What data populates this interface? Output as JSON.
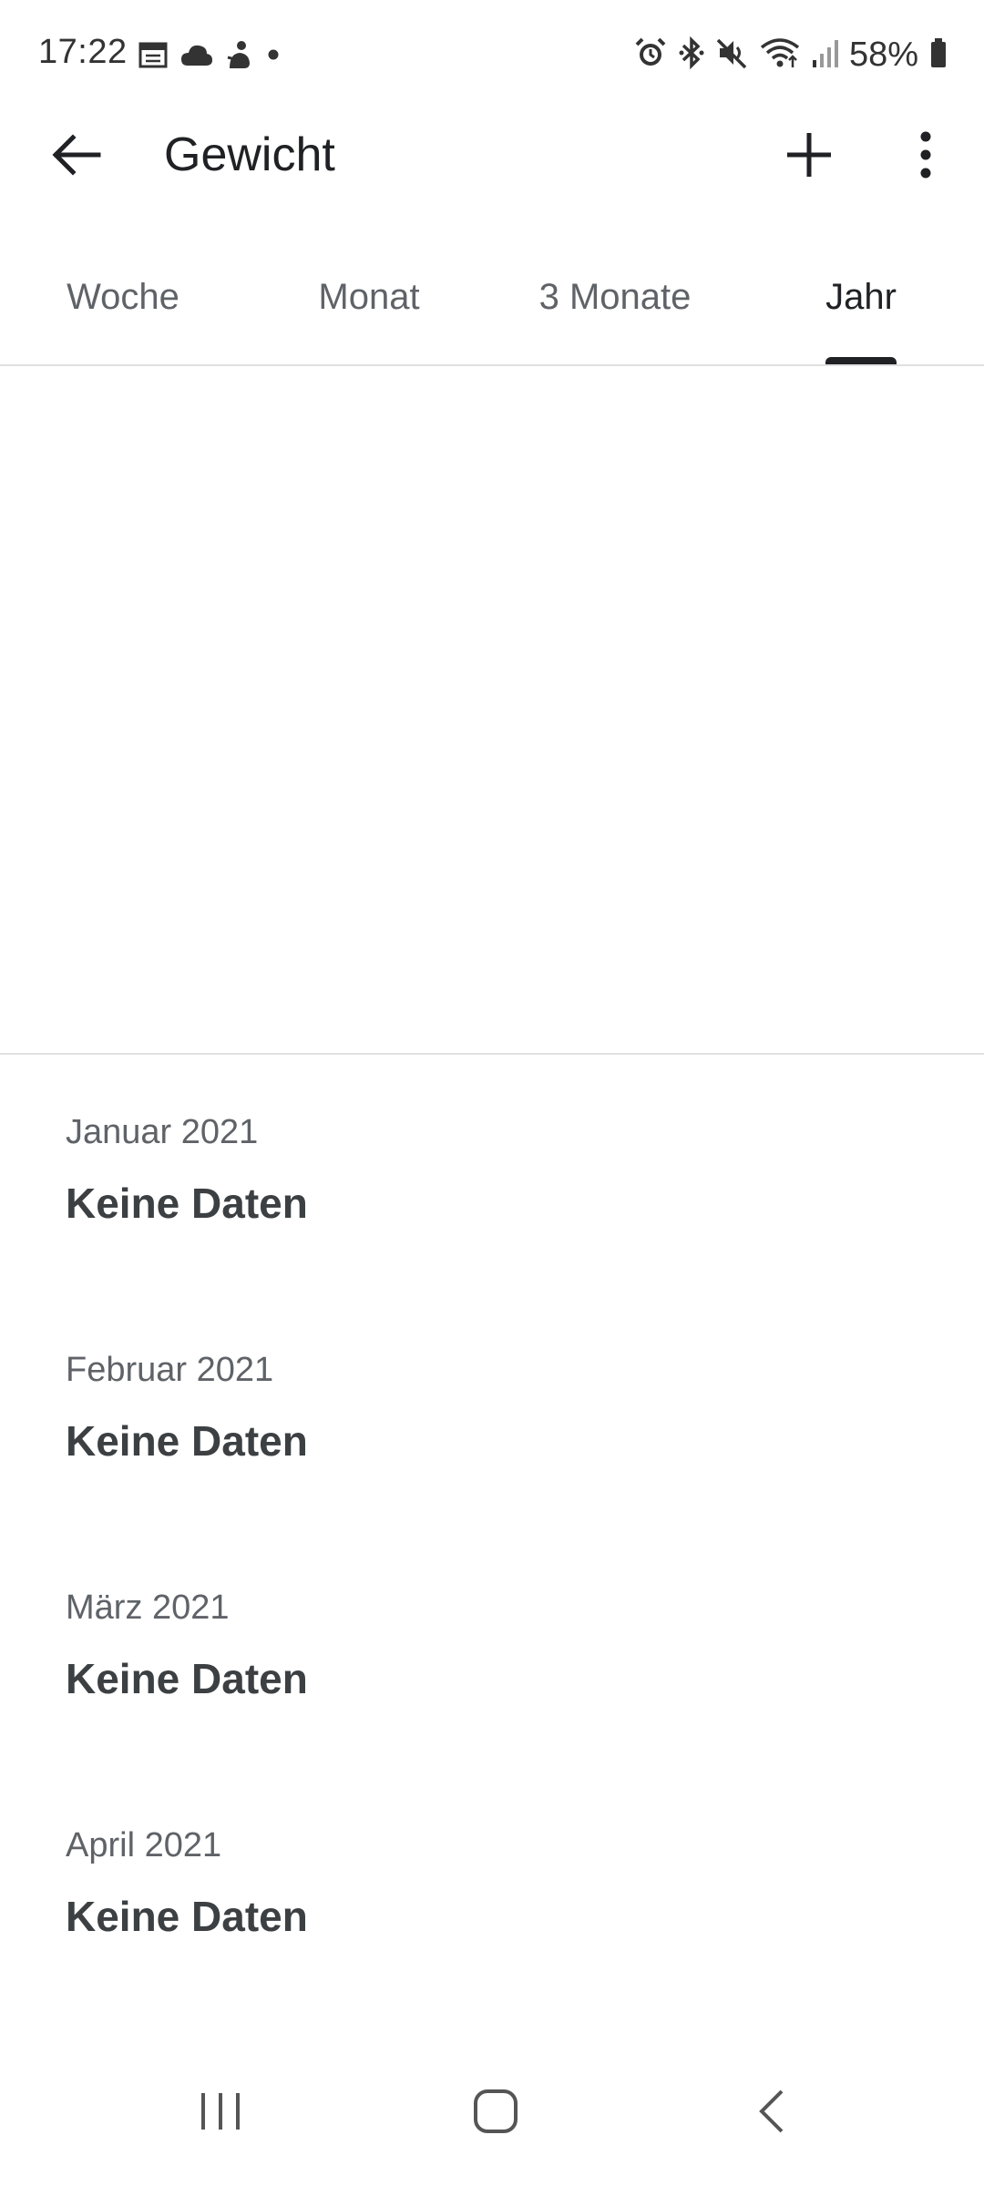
{
  "status_bar": {
    "time": "17:22",
    "left_icons": [
      "calendar-icon",
      "cloud-icon",
      "bixby-icon",
      "notification-dot-icon"
    ],
    "right_icons": [
      "alarm-icon",
      "bluetooth-icon",
      "mute-icon",
      "wifi-icon",
      "signal-icon"
    ],
    "battery_text": "58%"
  },
  "app_bar": {
    "title": "Gewicht",
    "back_icon": "arrow-back-icon",
    "add_icon": "add-icon",
    "more_icon": "more-vert-icon"
  },
  "tabs": {
    "items": [
      {
        "label": "Woche",
        "active": false
      },
      {
        "label": "Monat",
        "active": false
      },
      {
        "label": "3 Monate",
        "active": false
      },
      {
        "label": "Jahr",
        "active": true
      }
    ]
  },
  "months": [
    {
      "label": "Januar 2021",
      "value": "Keine Daten"
    },
    {
      "label": "Februar 2021",
      "value": "Keine Daten"
    },
    {
      "label": "März 2021",
      "value": "Keine Daten"
    },
    {
      "label": "April 2021",
      "value": "Keine Daten"
    }
  ],
  "nav_bar": {
    "recents_icon": "recents-icon",
    "home_icon": "home-icon",
    "back_icon": "nav-back-icon"
  },
  "colors": {
    "text_primary": "#202124",
    "text_secondary": "#5f6368",
    "divider": "#e0e0e0",
    "indicator": "#202124"
  }
}
